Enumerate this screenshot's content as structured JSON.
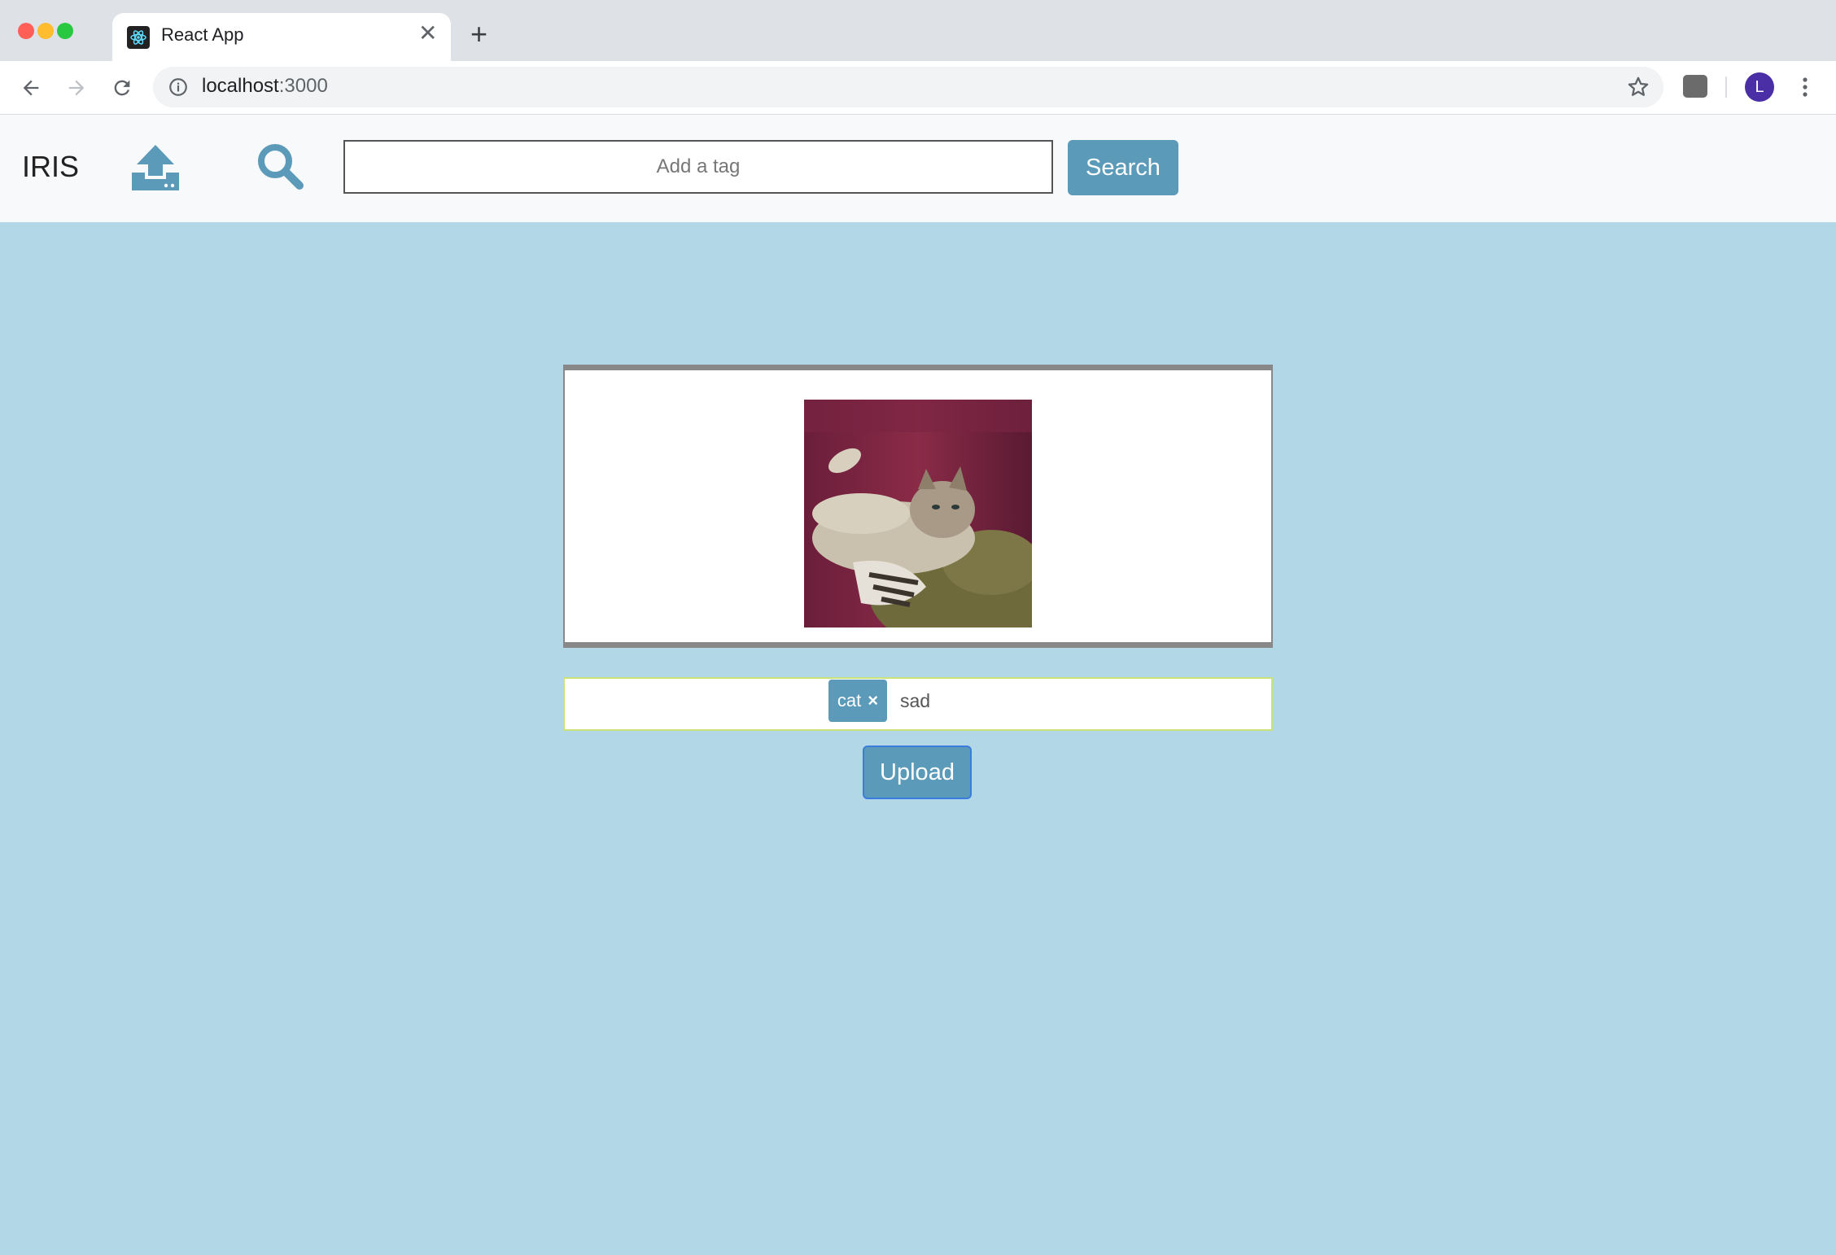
{
  "browser": {
    "tab_title": "React App",
    "tab_close_glyph": "✕",
    "new_tab_glyph": "+",
    "url_host": "localhost",
    "url_port": ":3000",
    "profile_initial": "L",
    "icons": [
      "back-icon",
      "forward-icon",
      "reload-icon",
      "info-icon",
      "star-icon",
      "extension-icon",
      "menu-icon"
    ]
  },
  "app": {
    "brand": "IRIS",
    "search_placeholder": "Add a tag",
    "search_button": "Search",
    "tags": [
      {
        "label": "cat",
        "remove_glyph": "×"
      }
    ],
    "tag_entry_value": "sad",
    "upload_button": "Upload",
    "colors": {
      "background": "#b2d8e7",
      "accent": "#5b9ab9",
      "navbar": "#f8f9fa"
    }
  }
}
